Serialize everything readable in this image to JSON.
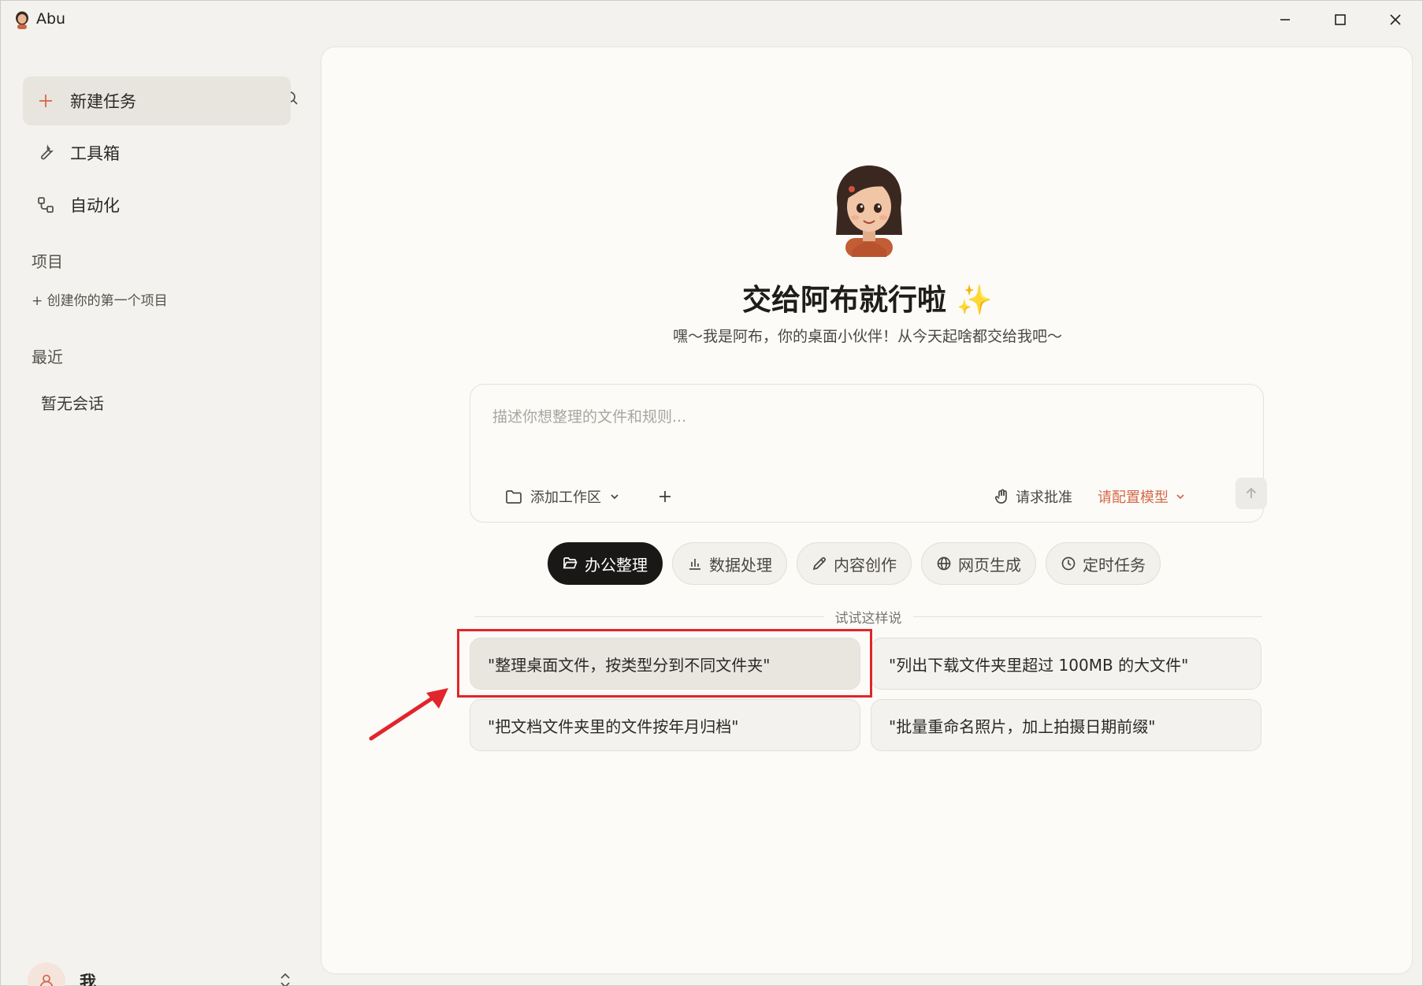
{
  "window": {
    "title": "Abu",
    "controls": {
      "minimize": "minimize",
      "maximize": "maximize",
      "close": "close"
    }
  },
  "sidebar": {
    "nav": [
      {
        "label": "新建任务",
        "icon": "plus-icon",
        "active": true
      },
      {
        "label": "工具箱",
        "icon": "wrench-icon",
        "active": false
      },
      {
        "label": "自动化",
        "icon": "flow-icon",
        "active": false
      }
    ],
    "projects_label": "项目",
    "create_project": "+ 创建你的第一个项目",
    "recent_label": "最近",
    "recent_empty": "暂无会话",
    "user_name": "我"
  },
  "main": {
    "title": "交给阿布就行啦",
    "title_emoji": "✨",
    "subtitle": "嘿～我是阿布，你的桌面小伙伴！从今天起啥都交给我吧～",
    "composer": {
      "placeholder": "描述你想整理的文件和规则...",
      "workspace_label": "添加工作区",
      "approve_label": "请求批准",
      "model_label": "请配置模型"
    },
    "chips": [
      {
        "label": "办公整理",
        "icon": "folder-open-icon",
        "active": true
      },
      {
        "label": "数据处理",
        "icon": "bar-chart-icon",
        "active": false
      },
      {
        "label": "内容创作",
        "icon": "pen-icon",
        "active": false
      },
      {
        "label": "网页生成",
        "icon": "globe-icon",
        "active": false
      },
      {
        "label": "定时任务",
        "icon": "clock-icon",
        "active": false
      }
    ],
    "suggestions_title": "试试这样说",
    "suggestions": [
      "\"整理桌面文件，按类型分到不同文件夹\"",
      "\"列出下载文件夹里超过 100MB 的大文件\"",
      "\"把文档文件夹里的文件按年月归档\"",
      "\"批量重命名照片，加上拍摄日期前缀\""
    ]
  },
  "colors": {
    "accent": "#d4694a",
    "annotation": "#e0262c",
    "chip_active_bg": "#1a1816",
    "sparkle": "#f0b429"
  }
}
